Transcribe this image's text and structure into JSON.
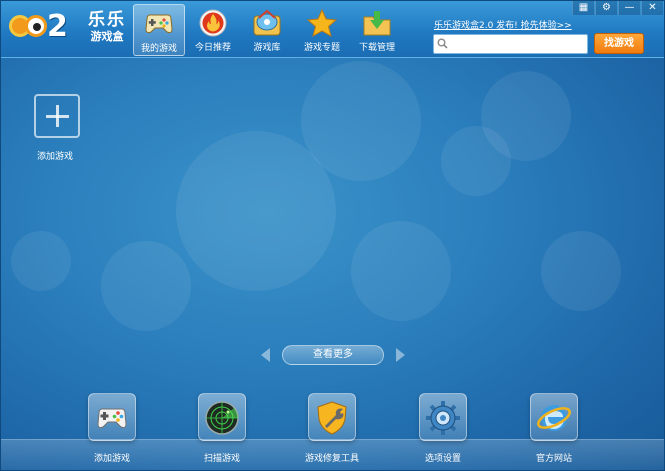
{
  "header": {
    "logo_mark": "2",
    "brand_line1": "乐乐",
    "brand_line2": "游戏盒"
  },
  "nav": [
    {
      "label": "我的游戏",
      "icon": "gamepad-icon",
      "active": true
    },
    {
      "label": "今日推荐",
      "icon": "fire-icon",
      "active": false
    },
    {
      "label": "游戏库",
      "icon": "game-library-icon",
      "active": false
    },
    {
      "label": "游戏专题",
      "icon": "star-icon",
      "active": false
    },
    {
      "label": "下载管理",
      "icon": "download-folder-icon",
      "active": false
    }
  ],
  "promo": {
    "text": "乐乐游戏盒2.0 发布! 抢先体验>>"
  },
  "search": {
    "placeholder": "",
    "value": "",
    "button_label": "找游戏"
  },
  "window_controls": {
    "skin": "▦",
    "settings": "⚙",
    "minimize": "—",
    "close": "✕"
  },
  "main": {
    "add_game_label": "添加游戏",
    "more_label": "查看更多"
  },
  "toolbar": [
    {
      "label": "添加游戏",
      "icon": "gamepad-icon"
    },
    {
      "label": "扫描游戏",
      "icon": "radar-icon"
    },
    {
      "label": "游戏修复工具",
      "icon": "repair-shield-icon"
    },
    {
      "label": "选项设置",
      "icon": "settings-gear-icon"
    },
    {
      "label": "官方网站",
      "icon": "browser-globe-icon"
    }
  ],
  "colors": {
    "accent_orange": "#f07b0d",
    "background_blue": "#2b7fbd"
  }
}
